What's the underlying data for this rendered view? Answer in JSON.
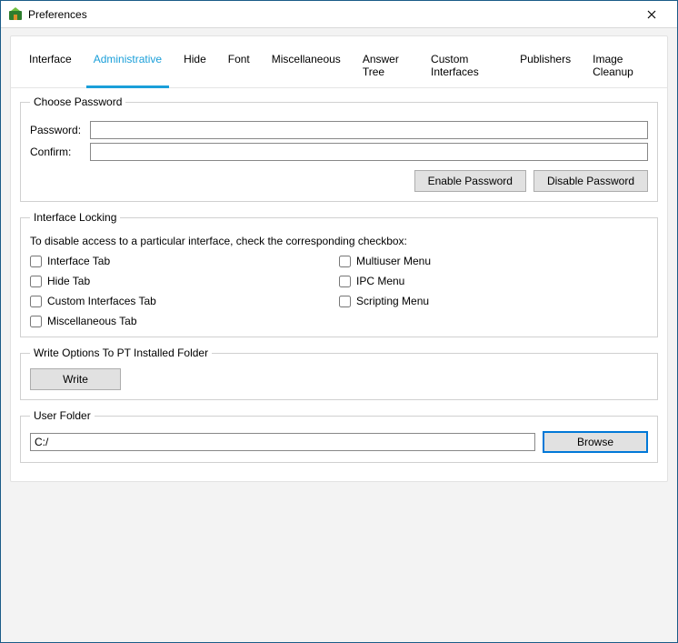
{
  "window": {
    "title": "Preferences"
  },
  "tabs": [
    {
      "label": "Interface"
    },
    {
      "label": "Administrative"
    },
    {
      "label": "Hide"
    },
    {
      "label": "Font"
    },
    {
      "label": "Miscellaneous"
    },
    {
      "label": "Answer Tree"
    },
    {
      "label": "Custom Interfaces"
    },
    {
      "label": "Publishers"
    },
    {
      "label": "Image Cleanup"
    }
  ],
  "active_tab_index": 1,
  "choose_password": {
    "legend": "Choose Password",
    "password_label": "Password:",
    "password_value": "",
    "confirm_label": "Confirm:",
    "confirm_value": "",
    "enable_btn": "Enable Password",
    "disable_btn": "Disable Password"
  },
  "interface_locking": {
    "legend": "Interface Locking",
    "help": "To disable access to a particular interface, check the corresponding checkbox:",
    "left": [
      {
        "label": "Interface Tab",
        "checked": false
      },
      {
        "label": "Hide Tab",
        "checked": false
      },
      {
        "label": "Custom Interfaces Tab",
        "checked": false
      },
      {
        "label": "Miscellaneous Tab",
        "checked": false
      }
    ],
    "right": [
      {
        "label": "Multiuser Menu",
        "checked": false
      },
      {
        "label": "IPC Menu",
        "checked": false
      },
      {
        "label": "Scripting Menu",
        "checked": false
      }
    ]
  },
  "write_options": {
    "legend": "Write Options To PT Installed Folder",
    "write_btn": "Write"
  },
  "user_folder": {
    "legend": "User Folder",
    "path": "C:/",
    "browse_btn": "Browse"
  }
}
